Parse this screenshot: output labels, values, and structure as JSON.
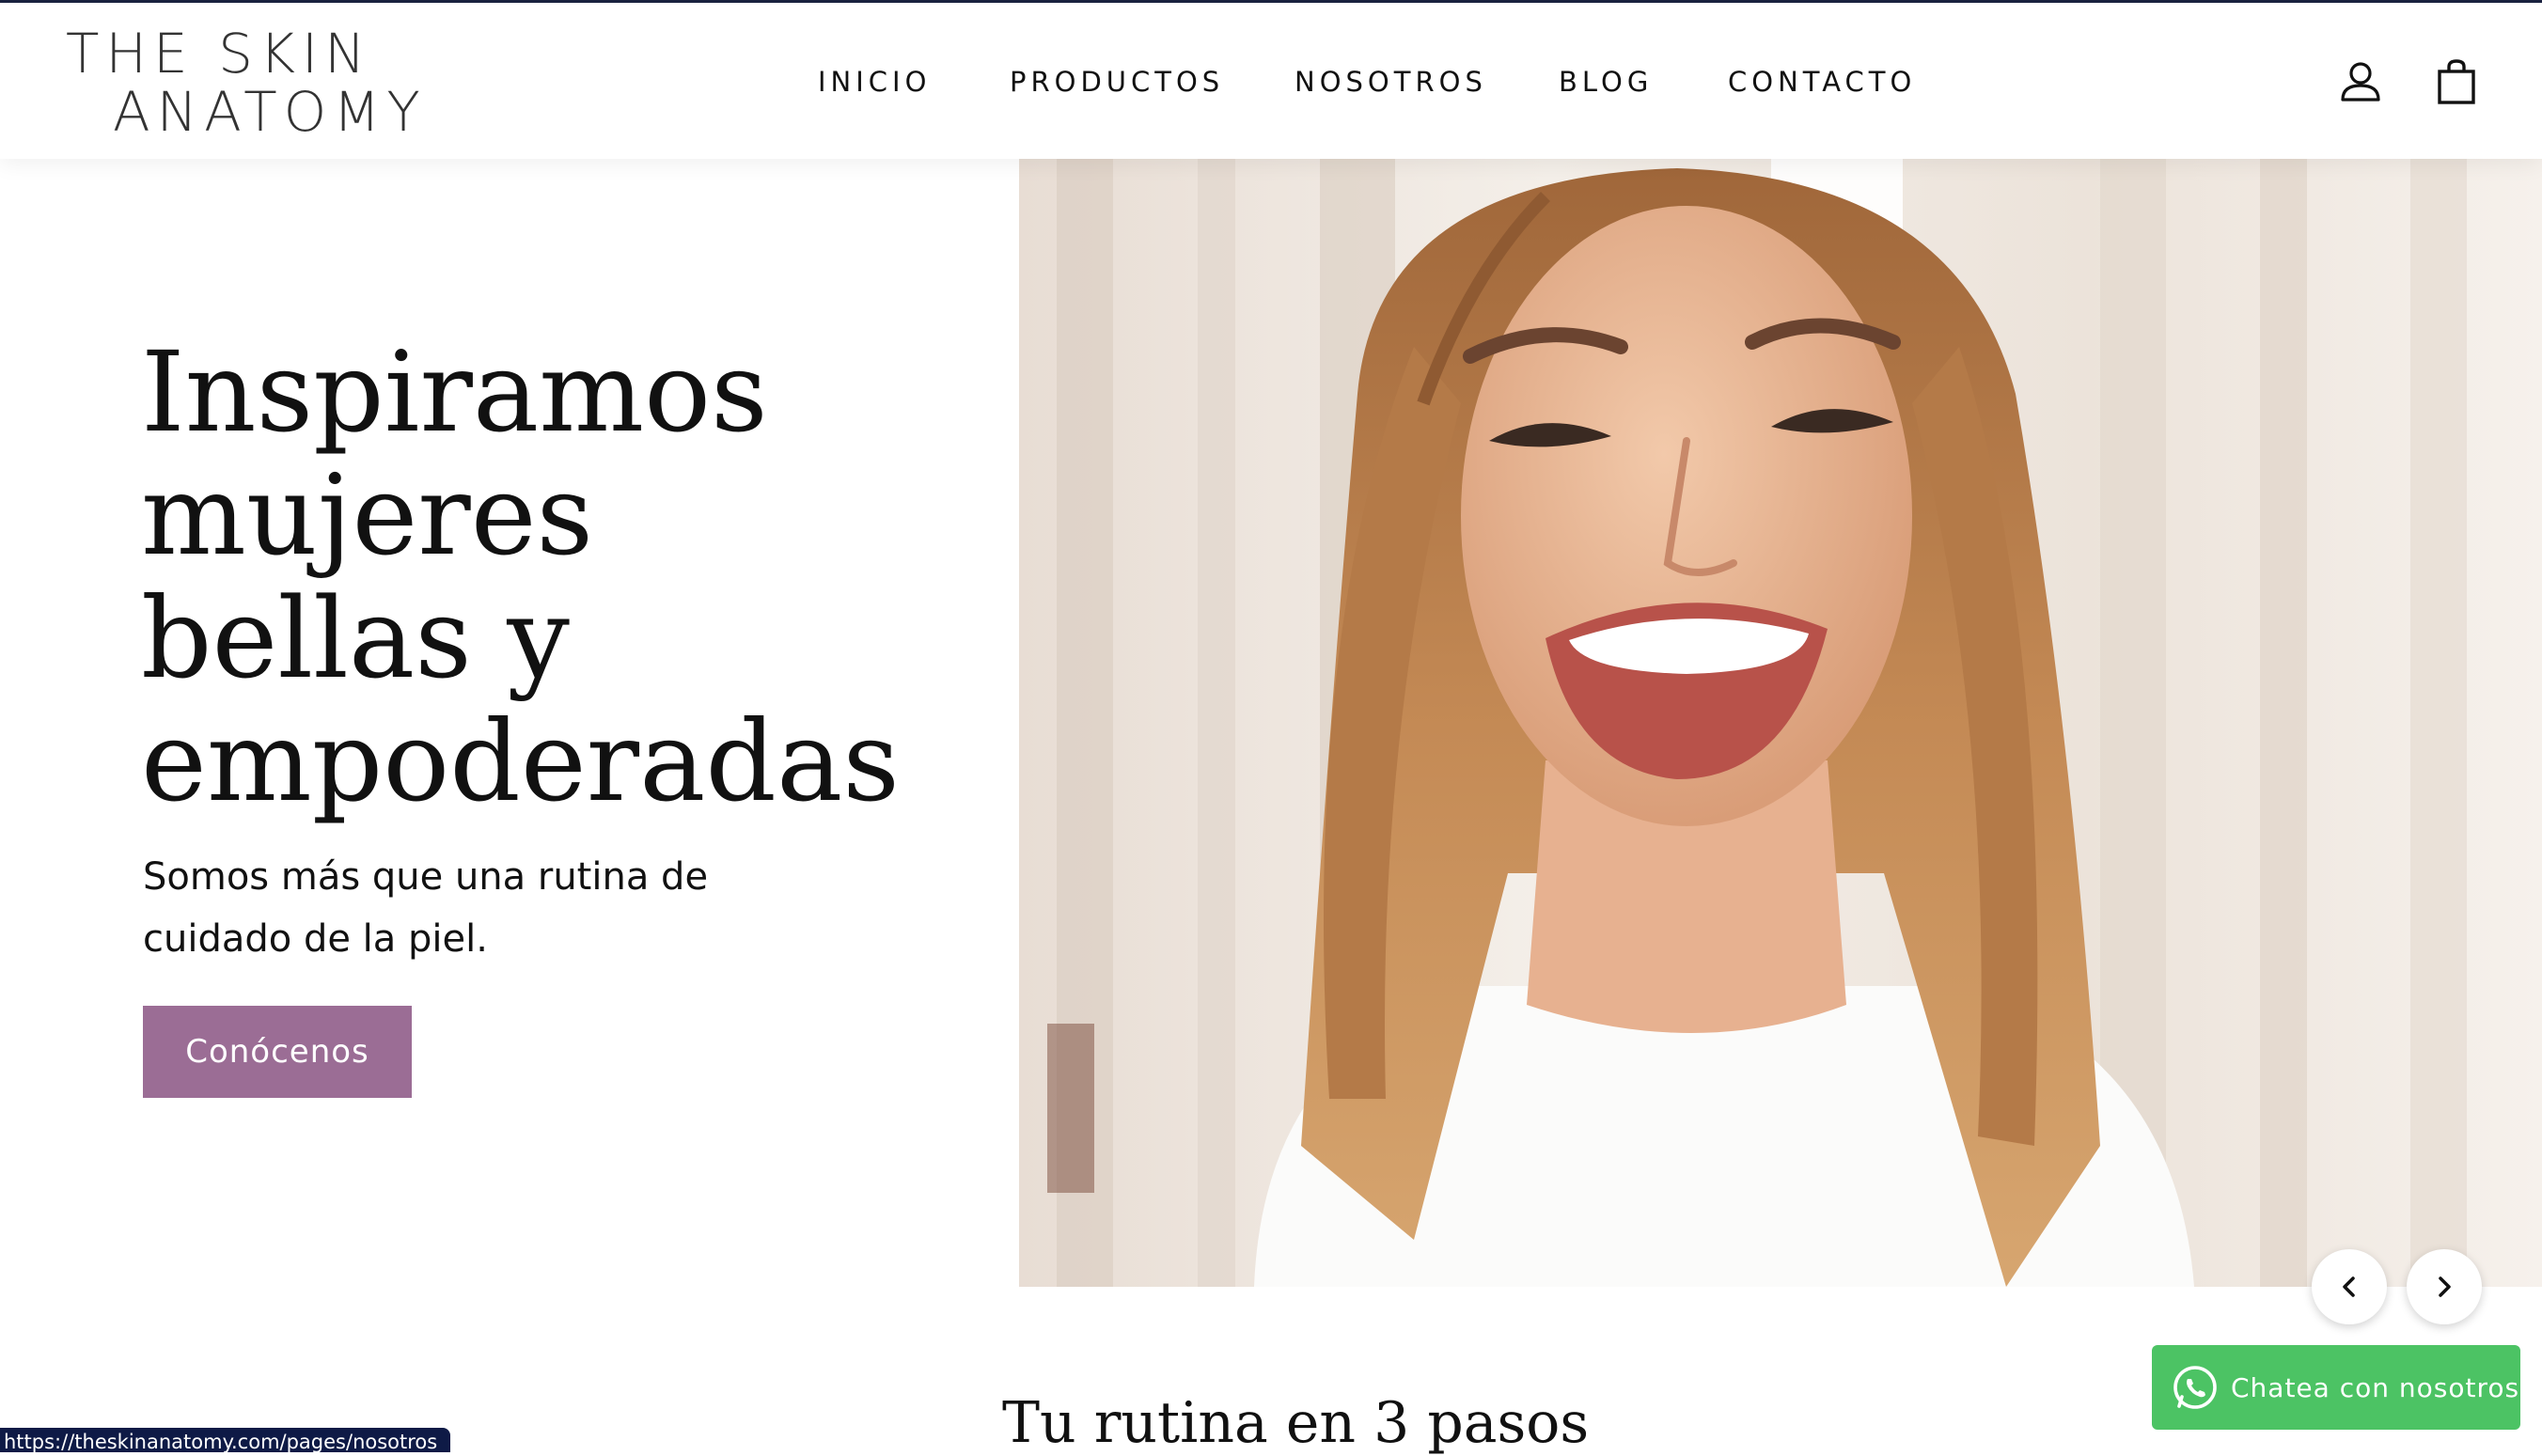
{
  "brand": {
    "line1": "THE SKIN",
    "line2": "ANATOMY"
  },
  "nav": {
    "items": [
      {
        "label": "INICIO"
      },
      {
        "label": "PRODUCTOS"
      },
      {
        "label": "NOSOTROS"
      },
      {
        "label": "BLOG"
      },
      {
        "label": "CONTACTO"
      }
    ]
  },
  "header_icons": {
    "account": "user-icon",
    "cart": "shopping-bag-icon"
  },
  "hero": {
    "headline_lines": [
      "Inspiramos",
      "mujeres",
      "bellas y",
      "empoderadas"
    ],
    "subtext_lines": [
      "Somos más que una rutina de",
      "cuidado de la piel."
    ],
    "cta_label": "Conócenos",
    "image_icon": "smiling-woman-photo",
    "prev_icon": "chevron-left-icon",
    "next_icon": "chevron-right-icon"
  },
  "section": {
    "title": "Tu rutina en 3 pasos"
  },
  "chat": {
    "label": "Chatea con nosotros",
    "icon": "whatsapp-icon"
  },
  "status_bar": {
    "url": "https://theskinanatomy.com/pages/nosotros"
  },
  "colors": {
    "accent": "#9b6d95",
    "whatsapp": "#4cc364",
    "topline": "#1b2340",
    "status_bg": "#0e1a46"
  }
}
